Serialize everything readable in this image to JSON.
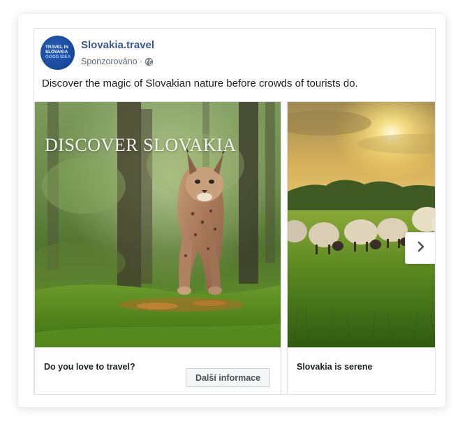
{
  "post": {
    "page_name": "Slovakia.travel",
    "sponsored_label": "Sponzorováno",
    "separator": "·",
    "body_text": "Discover the magic of Slovakian nature before crowds of tourists do.",
    "avatar_logo_lines": [
      "TRAVEL IN",
      "SLOVAKIA",
      "GOOD IDEA"
    ]
  },
  "carousel": {
    "cards": [
      {
        "image_overlay_text": "DISCOVER SLOVAKIA",
        "headline": "Do you love to travel?",
        "cta_label": "Další informace"
      },
      {
        "headline": "Slovakia is serene"
      }
    ],
    "next_icon": "chevron-right-icon"
  },
  "colors": {
    "link_blue": "#385898",
    "secondary_text": "#616770",
    "primary_text": "#1c1e21",
    "border": "#dddfe2"
  }
}
